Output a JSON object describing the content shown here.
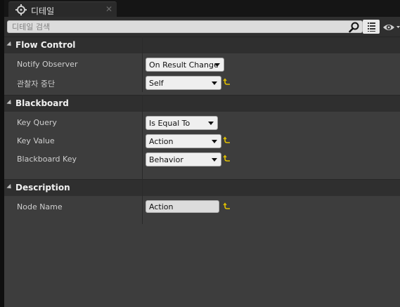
{
  "tab": {
    "title": "디테일",
    "close_glyph": "✕"
  },
  "search": {
    "placeholder": "디테일 검색"
  },
  "categories": [
    {
      "title": "Flow Control",
      "rows": [
        {
          "label": "Notify Observer",
          "value": "On Result Change",
          "control": "combo",
          "reset": false
        },
        {
          "label": "관찰자 중단",
          "value": "Self",
          "control": "combo",
          "reset": true
        }
      ]
    },
    {
      "title": "Blackboard",
      "rows": [
        {
          "label": "Key Query",
          "value": "Is Equal To",
          "control": "combo",
          "reset": false
        },
        {
          "label": "Key Value",
          "value": "Action",
          "control": "combo",
          "reset": true
        },
        {
          "label": "Blackboard Key",
          "value": "Behavior",
          "control": "combo",
          "reset": true
        }
      ]
    },
    {
      "title": "Description",
      "rows": [
        {
          "label": "Node Name",
          "value": "Action",
          "control": "text",
          "reset": true
        }
      ]
    }
  ],
  "colors": {
    "reset_yellow": "#e0c000"
  },
  "icons": {
    "tab": "details-icon",
    "search": "search-icon",
    "view_options": "list-view-icon",
    "visibility": "eye-icon",
    "reset": "reset-to-default-icon"
  }
}
